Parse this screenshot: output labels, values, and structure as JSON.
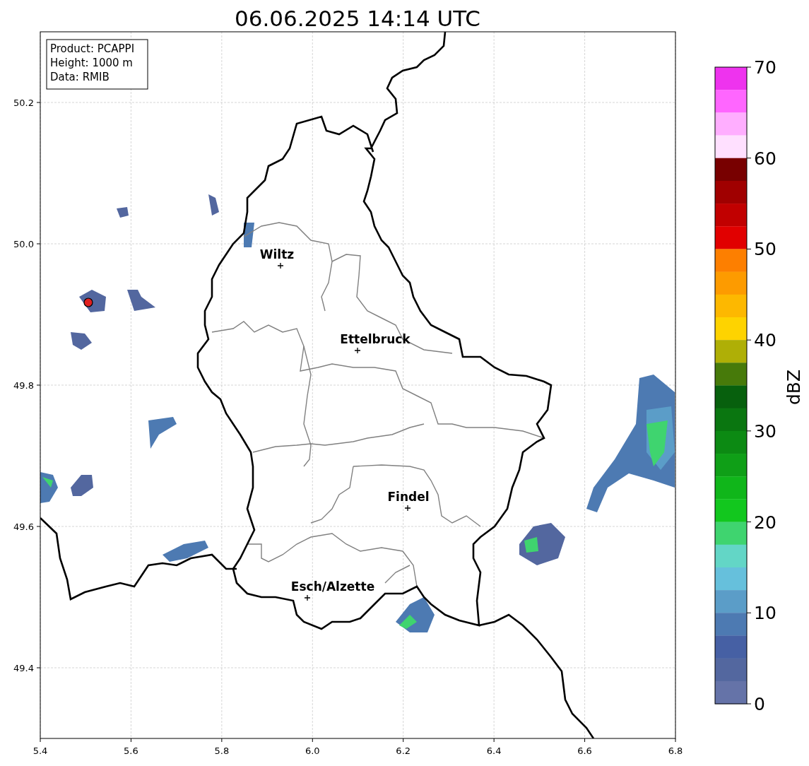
{
  "title": "06.06.2025 14:14 UTC",
  "info_box": [
    "Product: PCAPPI",
    "Height: 1000 m",
    "Data: RMIB"
  ],
  "cities": [
    {
      "name": "Wiltz"
    },
    {
      "name": "Ettelbruck"
    },
    {
      "name": "Findel"
    },
    {
      "name": "Esch/Alzette"
    }
  ],
  "x_ticks": [
    "5.4",
    "5.6",
    "5.8",
    "6.0",
    "6.2",
    "6.4",
    "6.6",
    "6.8"
  ],
  "y_ticks": [
    "50.2",
    "50.0",
    "49.8",
    "49.6",
    "49.4"
  ],
  "colorbar": {
    "label": "dBZ",
    "ticks": [
      "70",
      "60",
      "50",
      "40",
      "30",
      "20",
      "10",
      "0"
    ],
    "bins": [
      {
        "color": "#ee33ee"
      },
      {
        "color": "#ff66ff"
      },
      {
        "color": "#ffaeff"
      },
      {
        "color": "#ffe0ff"
      },
      {
        "color": "#780000"
      },
      {
        "color": "#a00000"
      },
      {
        "color": "#c10000"
      },
      {
        "color": "#e10000"
      },
      {
        "color": "#fd7f00"
      },
      {
        "color": "#fd9b00"
      },
      {
        "color": "#fdb800"
      },
      {
        "color": "#fed300"
      },
      {
        "color": "#afaf06"
      },
      {
        "color": "#477a0a"
      },
      {
        "color": "#07600d"
      },
      {
        "color": "#0a7610"
      },
      {
        "color": "#0c8a13"
      },
      {
        "color": "#0f9f17"
      },
      {
        "color": "#10b61a"
      },
      {
        "color": "#12c71e"
      },
      {
        "color": "#3fd46f"
      },
      {
        "color": "#63d6c6"
      },
      {
        "color": "#66c0dc"
      },
      {
        "color": "#5b9dc8"
      },
      {
        "color": "#4d7ab2"
      },
      {
        "color": "#4660a4"
      },
      {
        "color": "#53679f"
      },
      {
        "color": "#6573a8"
      }
    ]
  }
}
